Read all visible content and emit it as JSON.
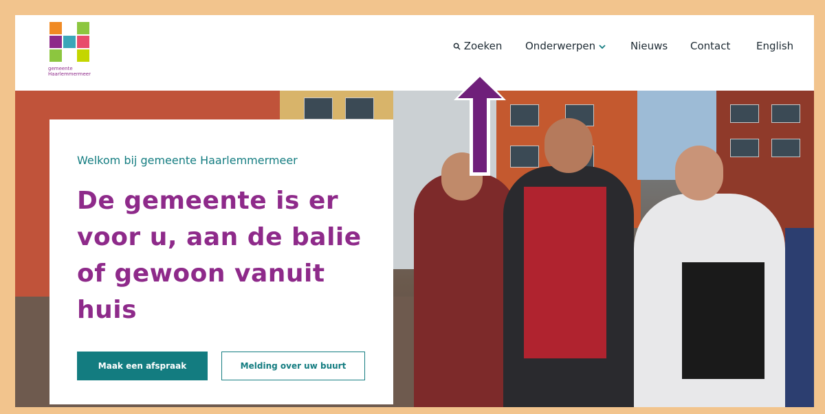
{
  "header": {
    "logo": {
      "line1": "gemeente",
      "line2": "Haarlemmermeer"
    },
    "nav": [
      {
        "label": "Zoeken",
        "icon": "search-icon"
      },
      {
        "label": "Onderwerpen",
        "icon": "chevron-down-icon"
      },
      {
        "label": "Nieuws"
      },
      {
        "label": "Contact"
      },
      {
        "label": "English"
      }
    ]
  },
  "hero": {
    "welcome": "Welkom bij gemeente Haarlemmermeer",
    "headline": "De gemeente is er voor u, aan de balie of gewoon vanuit huis",
    "primary_button": "Maak een afspraak",
    "secondary_button": "Melding over uw buurt"
  },
  "colors": {
    "brand_teal": "#137c80",
    "brand_purple": "#8e2a8a",
    "frame": "#f2c48d"
  }
}
